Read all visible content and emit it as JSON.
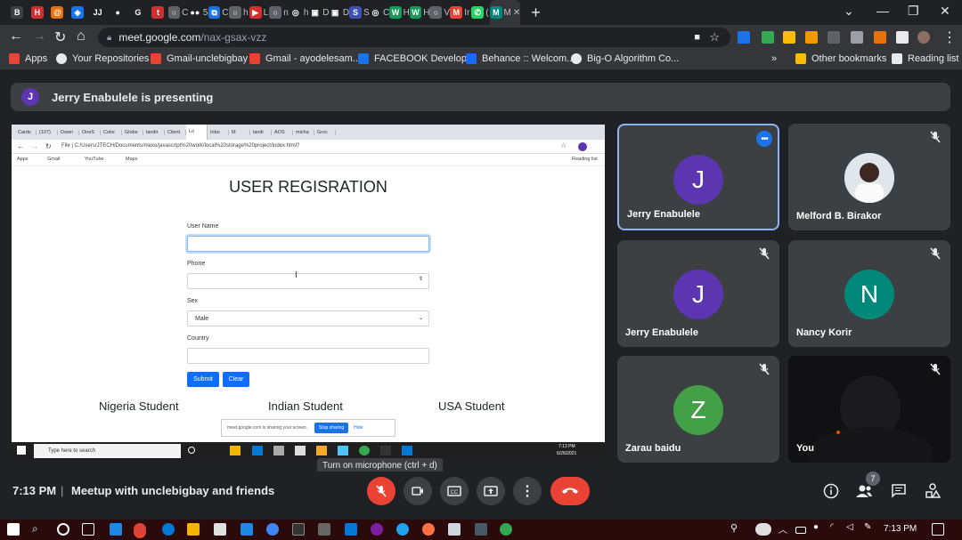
{
  "tabstrip": {
    "tabs": [
      {
        "icon": "B",
        "color": "#3c4043",
        "label": ""
      },
      {
        "icon": "H",
        "color": "#d32f2f",
        "label": ""
      },
      {
        "icon": "@",
        "color": "#e8710a",
        "label": ""
      },
      {
        "icon": "◆",
        "color": "#1a73e8",
        "label": ""
      },
      {
        "icon": "JJ",
        "color": "#202124",
        "label": ""
      },
      {
        "icon": "●",
        "color": "#202124",
        "label": ""
      },
      {
        "icon": "G",
        "color": "#202124",
        "label": ""
      },
      {
        "icon": "t",
        "color": "#d32f2f",
        "label": ""
      },
      {
        "icon": "○",
        "color": "#5f6368",
        "label": "C"
      },
      {
        "icon": "●●",
        "color": "#202124",
        "label": "5"
      },
      {
        "icon": "⧉",
        "color": "#1a73e8",
        "label": "C"
      },
      {
        "icon": "○",
        "color": "#5f6368",
        "label": "h"
      },
      {
        "icon": "▶",
        "color": "#d32f2f",
        "label": "L"
      },
      {
        "icon": "○",
        "color": "#5f6368",
        "label": "n"
      },
      {
        "icon": "◎",
        "color": "#202124",
        "label": "h"
      },
      {
        "icon": "▣",
        "color": "#202124",
        "label": "D"
      },
      {
        "icon": "▣",
        "color": "#202124",
        "label": "D"
      },
      {
        "icon": "S",
        "color": "#3f51b5",
        "label": "S"
      },
      {
        "icon": "◎",
        "color": "#202124",
        "label": "C"
      },
      {
        "icon": "W",
        "color": "#0f9d58",
        "label": "H"
      },
      {
        "icon": "W",
        "color": "#0f9d58",
        "label": "H"
      },
      {
        "icon": "○",
        "color": "#5f6368",
        "label": "V"
      },
      {
        "icon": "M",
        "color": "#ea4335",
        "label": "Ir"
      },
      {
        "icon": "✆",
        "color": "#25d366",
        "label": "("
      },
      {
        "icon": "M",
        "color": "#00897b",
        "label": "M"
      }
    ],
    "new_tab": "+"
  },
  "toolbar": {
    "url_host": "meet.google.com",
    "url_path": "/nax-gsax-vzz"
  },
  "bookmarks": [
    {
      "label": "Apps",
      "color": "#ea4335"
    },
    {
      "label": "Your Repositories",
      "color": "#e8eaed"
    },
    {
      "label": "Gmail-unclebigbay",
      "color": "#ea4335"
    },
    {
      "label": "Gmail - ayodelesam...",
      "color": "#ea4335"
    },
    {
      "label": "FACEBOOK Develop...",
      "color": "#1a73e8"
    },
    {
      "label": "Behance :: Welcom...",
      "color": "#1769ff"
    },
    {
      "label": "Big-O Algorithm Co...",
      "color": "#e8eaed"
    },
    {
      "label": "Other bookmarks",
      "color": "#fbbc04"
    },
    {
      "label": "Reading list",
      "color": "#e8eaed"
    }
  ],
  "presenting": {
    "avatar": "J",
    "text": "Jerry Enabulele is presenting"
  },
  "shared_screen": {
    "inner_tabs": [
      "Cards",
      "(107)",
      "Down",
      "OneS",
      "Color",
      "Globe",
      "landir",
      "Client",
      "Lo",
      "Inbo",
      "M",
      "landi",
      "AOS",
      "micha",
      "Groc"
    ],
    "inner_url": "File  |  C:/Users/JTECH/Documents/mexo/javascript%20work/local%20storage%20project/index.html?",
    "inner_bookmarks": [
      "Apps",
      "Gmail",
      "YouTube",
      "Maps"
    ],
    "inner_reading_list": "Reading list",
    "form_title": "USER REGISRATION",
    "labels": {
      "username": "User Name",
      "phone": "Phone",
      "sex": "Sex",
      "country": "Country"
    },
    "sex_value": "Male",
    "submit": "Submit",
    "clear": "Clear",
    "sections": [
      "Nigeria Student",
      "Indian Student",
      "USA Student"
    ],
    "share_msg": "meet.google.com is sharing your screen.",
    "stop_sharing": "Stop sharing",
    "hide": "Hide",
    "taskbar_search": "Type here to search",
    "taskbar_time": "7:13 PM",
    "taskbar_date": "6/26/2021"
  },
  "tooltip": "Turn on microphone (ctrl + d)",
  "participants": [
    {
      "name": "Jerry Enabulele",
      "initial": "J",
      "color": "#5e35b1",
      "active": true
    },
    {
      "name": "Melford B. Birakor",
      "initial": "",
      "color": "#cfd8dc",
      "photo": true
    },
    {
      "name": "Jerry Enabulele",
      "initial": "J",
      "color": "#5e35b1"
    },
    {
      "name": "Nancy Korir",
      "initial": "N",
      "color": "#00897b"
    },
    {
      "name": "Zarau baidu",
      "initial": "Z",
      "color": "#43a047"
    },
    {
      "name": "You",
      "initial": "",
      "color": "#111",
      "video": true
    }
  ],
  "bottombar": {
    "time": "7:13 PM",
    "meeting_name": "Meetup with unclebigbay and friends",
    "participant_count": "7"
  },
  "taskbar": {
    "time": "7:13 PM"
  }
}
